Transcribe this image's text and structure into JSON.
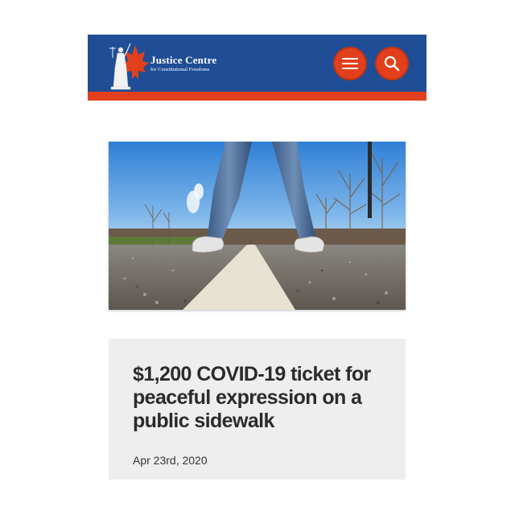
{
  "header": {
    "brand_name": "Justice Centre",
    "brand_subtitle": "for Constitutional Freedoms",
    "colors": {
      "bar": "#1f4e96",
      "accent": "#e2401c"
    },
    "menu_icon": "hamburger-menu-icon",
    "search_icon": "search-icon"
  },
  "hero": {
    "image_subject": "legs of a person standing on a road center line"
  },
  "article": {
    "title": "$1,200 COVID-19 ticket for peaceful expression on a public sidewalk",
    "date": "Apr 23rd, 2020"
  }
}
